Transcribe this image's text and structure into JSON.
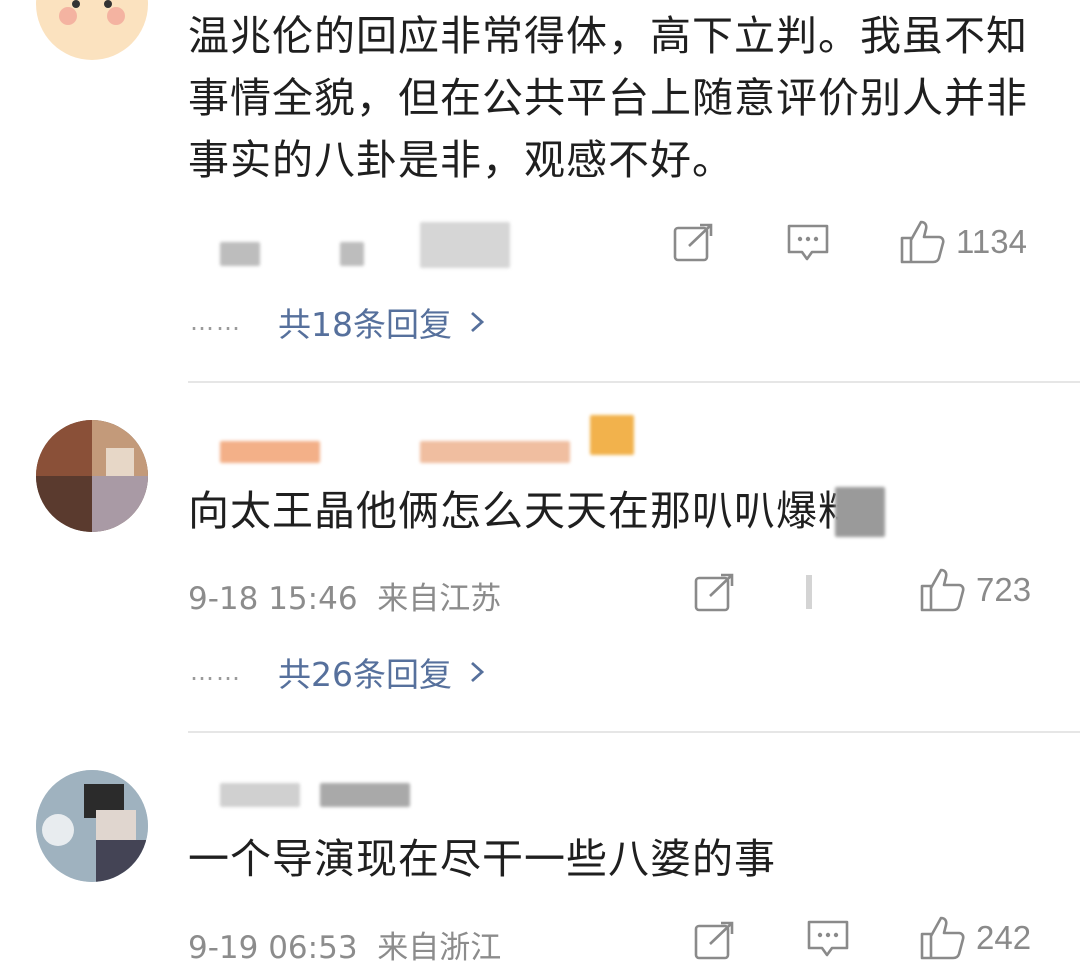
{
  "comments": [
    {
      "text": "温兆伦的回应非常得体，高下立判。我虽不知事情全貌，但在公共平台上随意评价别人并非事实的八卦是非，观感不好。",
      "meta": "",
      "likes": "1134",
      "replies_dots": "……",
      "replies_label": "共18条回复"
    },
    {
      "text": "向太王晶他俩怎么天天在那叭叭爆料",
      "meta": "9-18 15:46  来自江苏",
      "likes": "723",
      "replies_dots": "……",
      "replies_label": "共26条回复"
    },
    {
      "text": "一个导演现在尽干一些八婆的事",
      "meta": "9-19 06:53  来自浙江",
      "likes": "242"
    }
  ],
  "icons": {
    "share": "share-icon",
    "comment": "comment-icon",
    "like": "like-icon",
    "chevron": "chevron-right-icon"
  },
  "colors": {
    "reply_link": "#56709c",
    "meta_text": "#8c8c8c"
  }
}
